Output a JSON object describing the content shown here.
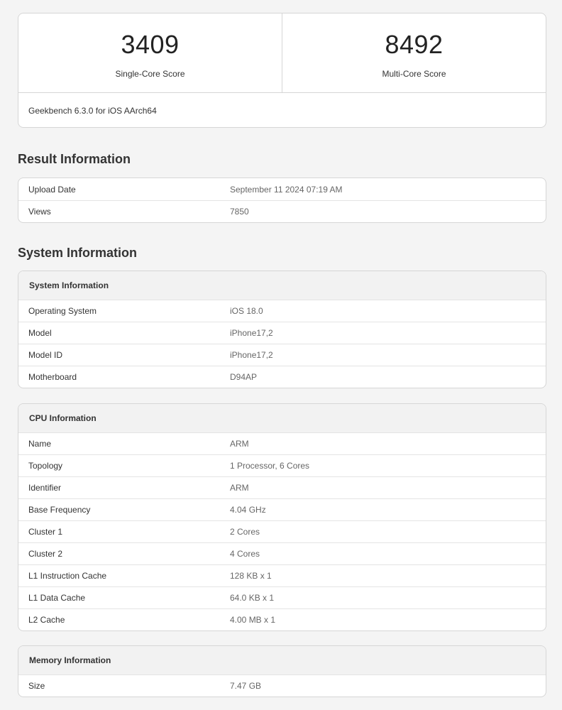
{
  "scores": {
    "single_core": {
      "value": "3409",
      "label": "Single-Core Score"
    },
    "multi_core": {
      "value": "8492",
      "label": "Multi-Core Score"
    },
    "version": "Geekbench 6.3.0 for iOS AArch64"
  },
  "result_information": {
    "title": "Result Information",
    "rows": [
      {
        "key": "Upload Date",
        "value": "September 11 2024 07:19 AM"
      },
      {
        "key": "Views",
        "value": "7850"
      }
    ]
  },
  "system_information": {
    "title": "System Information",
    "system": {
      "header": "System Information",
      "rows": [
        {
          "key": "Operating System",
          "value": "iOS 18.0"
        },
        {
          "key": "Model",
          "value": "iPhone17,2"
        },
        {
          "key": "Model ID",
          "value": "iPhone17,2"
        },
        {
          "key": "Motherboard",
          "value": "D94AP"
        }
      ]
    },
    "cpu": {
      "header": "CPU Information",
      "rows": [
        {
          "key": "Name",
          "value": "ARM"
        },
        {
          "key": "Topology",
          "value": "1 Processor, 6 Cores"
        },
        {
          "key": "Identifier",
          "value": "ARM"
        },
        {
          "key": "Base Frequency",
          "value": "4.04 GHz"
        },
        {
          "key": "Cluster 1",
          "value": "2 Cores"
        },
        {
          "key": "Cluster 2",
          "value": "4 Cores"
        },
        {
          "key": "L1 Instruction Cache",
          "value": "128 KB x 1"
        },
        {
          "key": "L1 Data Cache",
          "value": "64.0 KB x 1"
        },
        {
          "key": "L2 Cache",
          "value": "4.00 MB x 1"
        }
      ]
    },
    "memory": {
      "header": "Memory Information",
      "rows": [
        {
          "key": "Size",
          "value": "7.47 GB"
        }
      ]
    }
  }
}
